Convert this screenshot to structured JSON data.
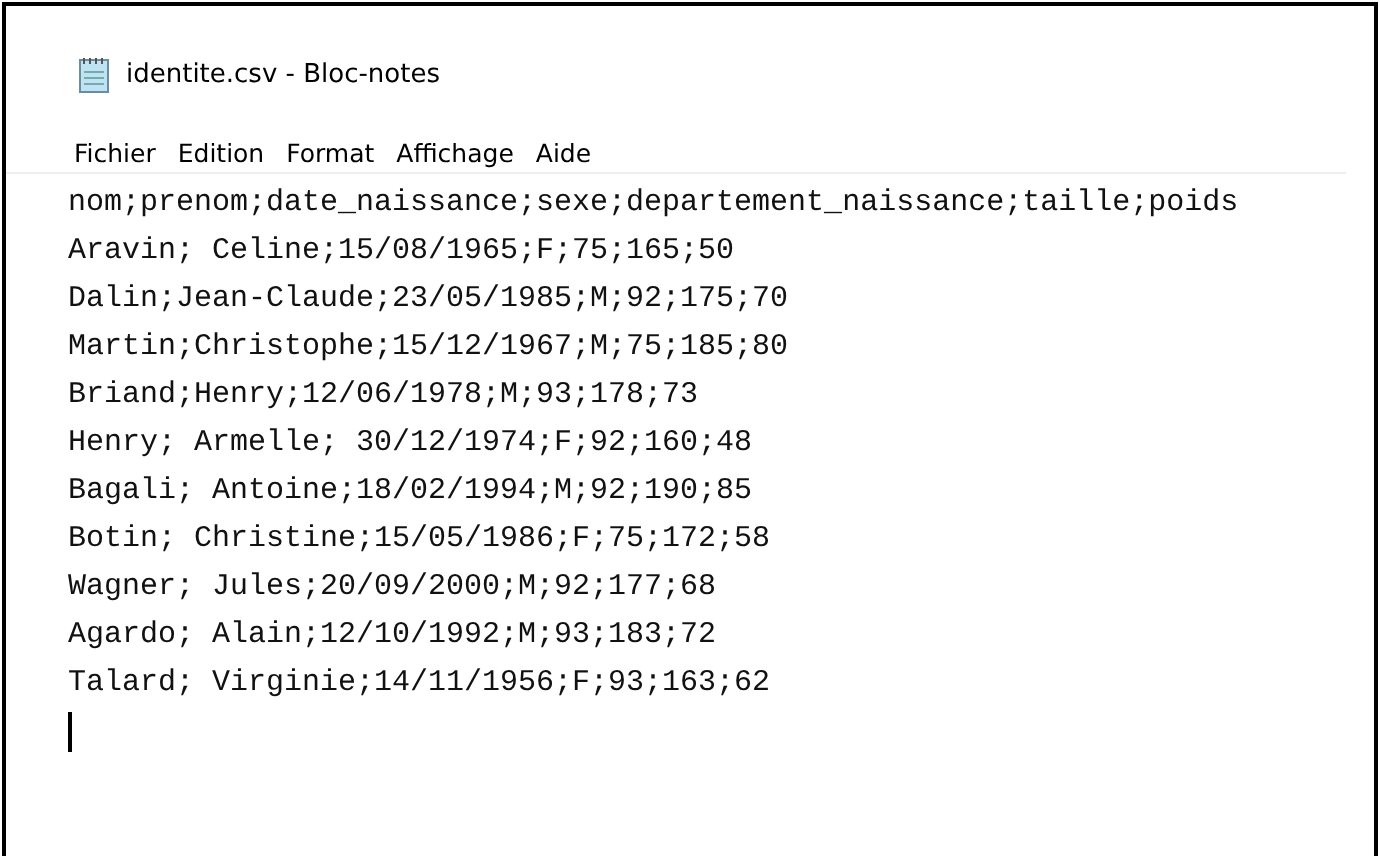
{
  "window": {
    "title": "identite.csv - Bloc-notes"
  },
  "menu": [
    "Fichier",
    "Edition",
    "Format",
    "Affichage",
    "Aide"
  ],
  "lines": [
    "nom;prenom;date_naissance;sexe;departement_naissance;taille;poids",
    "Aravin; Celine;15/08/1965;F;75;165;50",
    "Dalin;Jean-Claude;23/05/1985;M;92;175;70",
    "Martin;Christophe;15/12/1967;M;75;185;80",
    "Briand;Henry;12/06/1978;M;93;178;73",
    "Henry; Armelle; 30/12/1974;F;92;160;48",
    "Bagali; Antoine;18/02/1994;M;92;190;85",
    "Botin; Christine;15/05/1986;F;75;172;58",
    "Wagner; Jules;20/09/2000;M;92;177;68",
    "Agardo; Alain;12/10/1992;M;93;183;72",
    "Talard; Virginie;14/11/1956;F;93;163;62"
  ]
}
